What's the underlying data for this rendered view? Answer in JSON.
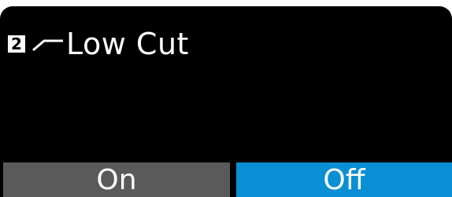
{
  "menu": {
    "channel_number": "2",
    "icon": "low-cut-filter-icon",
    "title": "Low Cut"
  },
  "options": {
    "on_label": "On",
    "off_label": "Off",
    "selected": "Off"
  },
  "colors": {
    "background": "#000000",
    "selected": "#0a8fd4",
    "unselected": "#5a5a5a",
    "text": "#ffffff"
  }
}
